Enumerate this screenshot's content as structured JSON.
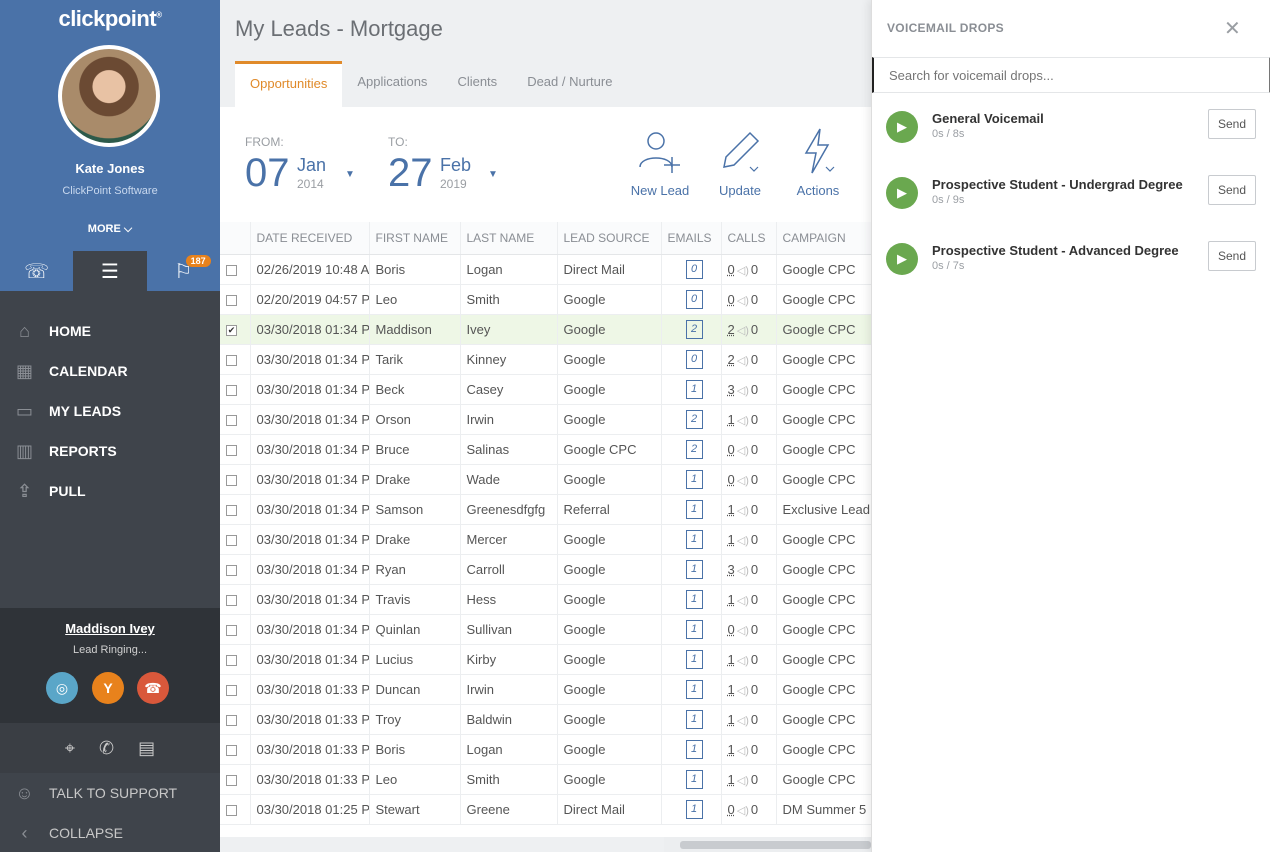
{
  "sidebar": {
    "logo": "clickpoint",
    "logo_mark": "®",
    "user_name": "Kate Jones",
    "company": "ClickPoint Software",
    "more_label": "MORE",
    "flag_badge": "187",
    "nav": [
      {
        "label": "HOME",
        "icon": "home-icon"
      },
      {
        "label": "CALENDAR",
        "icon": "calendar-icon"
      },
      {
        "label": "MY LEADS",
        "icon": "folder-icon"
      },
      {
        "label": "REPORTS",
        "icon": "bar-chart-icon"
      },
      {
        "label": "PULL",
        "icon": "upload-icon"
      }
    ],
    "call": {
      "caller": "Maddison Ivey",
      "status": "Lead Ringing..."
    },
    "talk_to_support": "TALK TO SUPPORT",
    "collapse": "COLLAPSE"
  },
  "main": {
    "title": "My Leads - Mortgage",
    "tabs": [
      "Opportunities",
      "Applications",
      "Clients",
      "Dead / Nurture"
    ],
    "active_tab": "Opportunities",
    "from": {
      "label": "FROM:",
      "day": "07",
      "month": "Jan",
      "year": "2014"
    },
    "to": {
      "label": "TO:",
      "day": "27",
      "month": "Feb",
      "year": "2019"
    },
    "toolbar": {
      "new_lead": "New Lead",
      "update": "Update",
      "actions": "Actions"
    },
    "columns": [
      "DATE RECEIVED",
      "FIRST NAME",
      "LAST NAME",
      "LEAD SOURCE",
      "EMAILS",
      "CALLS",
      "CAMPAIGN"
    ],
    "rows": [
      {
        "date": "02/26/2019 10:48 A",
        "first": "Boris",
        "last": "Logan",
        "source": "Direct Mail",
        "emails": "0",
        "calls": "0",
        "vm": "0",
        "campaign": "Google CPC",
        "checked": false
      },
      {
        "date": "02/20/2019 04:57 P",
        "first": "Leo",
        "last": "Smith",
        "source": "Google",
        "emails": "0",
        "calls": "0",
        "vm": "0",
        "campaign": "Google CPC",
        "checked": false
      },
      {
        "date": "03/30/2018 01:34 P",
        "first": "Maddison",
        "last": "Ivey",
        "source": "Google",
        "emails": "2",
        "calls": "2",
        "vm": "0",
        "campaign": "Google CPC",
        "checked": true
      },
      {
        "date": "03/30/2018 01:34 P",
        "first": "Tarik",
        "last": "Kinney",
        "source": "Google",
        "emails": "0",
        "calls": "2",
        "vm": "0",
        "campaign": "Google CPC",
        "checked": false
      },
      {
        "date": "03/30/2018 01:34 P",
        "first": "Beck",
        "last": "Casey",
        "source": "Google",
        "emails": "1",
        "calls": "3",
        "vm": "0",
        "campaign": "Google CPC",
        "checked": false
      },
      {
        "date": "03/30/2018 01:34 P",
        "first": "Orson",
        "last": "Irwin",
        "source": "Google",
        "emails": "2",
        "calls": "1",
        "vm": "0",
        "campaign": "Google CPC",
        "checked": false
      },
      {
        "date": "03/30/2018 01:34 P",
        "first": "Bruce",
        "last": "Salinas",
        "source": "Google CPC",
        "emails": "2",
        "calls": "0",
        "vm": "0",
        "campaign": "Google CPC",
        "checked": false
      },
      {
        "date": "03/30/2018 01:34 P",
        "first": "Drake",
        "last": "Wade",
        "source": "Google",
        "emails": "1",
        "calls": "0",
        "vm": "0",
        "campaign": "Google CPC",
        "checked": false
      },
      {
        "date": "03/30/2018 01:34 P",
        "first": "Samson",
        "last": "Greenesdfgfg",
        "source": "Referral",
        "emails": "1",
        "calls": "1",
        "vm": "0",
        "campaign": "Exclusive Lead",
        "checked": false
      },
      {
        "date": "03/30/2018 01:34 P",
        "first": "Drake",
        "last": "Mercer",
        "source": "Google",
        "emails": "1",
        "calls": "1",
        "vm": "0",
        "campaign": "Google CPC",
        "checked": false
      },
      {
        "date": "03/30/2018 01:34 P",
        "first": "Ryan",
        "last": "Carroll",
        "source": "Google",
        "emails": "1",
        "calls": "3",
        "vm": "0",
        "campaign": "Google CPC",
        "checked": false
      },
      {
        "date": "03/30/2018 01:34 P",
        "first": "Travis",
        "last": "Hess",
        "source": "Google",
        "emails": "1",
        "calls": "1",
        "vm": "0",
        "campaign": "Google CPC",
        "checked": false
      },
      {
        "date": "03/30/2018 01:34 P",
        "first": "Quinlan",
        "last": "Sullivan",
        "source": "Google",
        "emails": "1",
        "calls": "0",
        "vm": "0",
        "campaign": "Google CPC",
        "checked": false
      },
      {
        "date": "03/30/2018 01:34 P",
        "first": "Lucius",
        "last": "Kirby",
        "source": "Google",
        "emails": "1",
        "calls": "1",
        "vm": "0",
        "campaign": "Google CPC",
        "checked": false
      },
      {
        "date": "03/30/2018 01:33 P",
        "first": "Duncan",
        "last": "Irwin",
        "source": "Google",
        "emails": "1",
        "calls": "1",
        "vm": "0",
        "campaign": "Google CPC",
        "checked": false
      },
      {
        "date": "03/30/2018 01:33 P",
        "first": "Troy",
        "last": "Baldwin",
        "source": "Google",
        "emails": "1",
        "calls": "1",
        "vm": "0",
        "campaign": "Google CPC",
        "checked": false
      },
      {
        "date": "03/30/2018 01:33 P",
        "first": "Boris",
        "last": "Logan",
        "source": "Google",
        "emails": "1",
        "calls": "1",
        "vm": "0",
        "campaign": "Google CPC",
        "checked": false
      },
      {
        "date": "03/30/2018 01:33 P",
        "first": "Leo",
        "last": "Smith",
        "source": "Google",
        "emails": "1",
        "calls": "1",
        "vm": "0",
        "campaign": "Google CPC",
        "checked": false
      },
      {
        "date": "03/30/2018 01:25 P",
        "first": "Stewart",
        "last": "Greene",
        "source": "Direct Mail",
        "emails": "1",
        "calls": "0",
        "vm": "0",
        "campaign": "DM Summer 5",
        "checked": false
      }
    ]
  },
  "voicemail": {
    "title": "VOICEMAIL DROPS",
    "search_placeholder": "Search for voicemail drops...",
    "send_label": "Send",
    "items": [
      {
        "name": "General Voicemail",
        "duration": "0s / 8s"
      },
      {
        "name": "Prospective Student - Undergrad Degree",
        "duration": "0s / 9s"
      },
      {
        "name": "Prospective Student - Advanced Degree",
        "duration": "0s / 7s"
      }
    ]
  },
  "colors": {
    "brand_blue": "#4a72a8",
    "accent_orange": "#e08a2a",
    "play_green": "#6aa84f"
  }
}
